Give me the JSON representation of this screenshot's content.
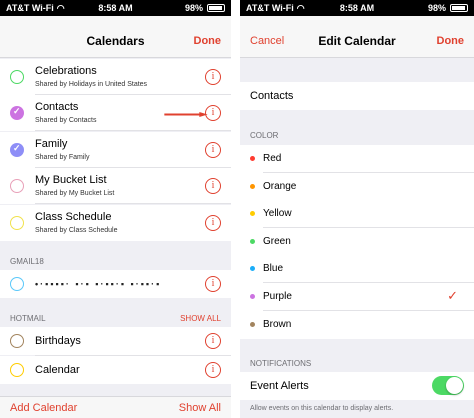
{
  "left": {
    "status": {
      "carrier": "AT&T Wi-Fi",
      "time": "8:58 AM",
      "battery": "98%"
    },
    "nav": {
      "title": "Calendars",
      "done": "Done"
    },
    "calendars": [
      {
        "name": "Celebrations",
        "sub": "Shared by Holidays in United States",
        "color": "#4cd964",
        "checked": false
      },
      {
        "name": "Contacts",
        "sub": "Shared by Contacts",
        "color": "#cc73e1",
        "checked": true
      },
      {
        "name": "Family",
        "sub": "Shared by Family",
        "color": "#8e8ef7",
        "checked": true
      },
      {
        "name": "My Bucket List",
        "sub": "Shared by My Bucket List",
        "color": "#e8a0b8",
        "checked": false
      },
      {
        "name": "Class Schedule",
        "sub": "Shared by Class Schedule",
        "color": "#f1e24c",
        "checked": false
      }
    ],
    "gmail": {
      "label": "GMAIL18",
      "account": "•·▪▪▪▪·  ▪·▪  ▪·▪▪·▪  ▪·▪▪·▪",
      "color": "#5ac8fa"
    },
    "hotmail": {
      "label": "HOTMAIL",
      "show_all": "SHOW ALL",
      "items": [
        {
          "name": "Birthdays",
          "color": "#a2845e"
        },
        {
          "name": "Calendar",
          "color": "#ffcc00"
        }
      ]
    },
    "bottom": {
      "add": "Add Calendar",
      "show_all": "Show All"
    }
  },
  "right": {
    "status": {
      "carrier": "AT&T Wi-Fi",
      "time": "8:58 AM",
      "battery": "98%"
    },
    "nav": {
      "cancel": "Cancel",
      "title": "Edit Calendar",
      "done": "Done"
    },
    "calendar_name": "Contacts",
    "color_label": "COLOR",
    "colors": [
      {
        "name": "Red",
        "hex": "#ff3b30"
      },
      {
        "name": "Orange",
        "hex": "#ff9500"
      },
      {
        "name": "Yellow",
        "hex": "#ffcc00"
      },
      {
        "name": "Green",
        "hex": "#4cd964"
      },
      {
        "name": "Blue",
        "hex": "#1badf8"
      },
      {
        "name": "Purple",
        "hex": "#cc73e1"
      },
      {
        "name": "Brown",
        "hex": "#a2845e"
      }
    ],
    "selected_color": "Purple",
    "notifications_label": "NOTIFICATIONS",
    "event_alerts": "Event Alerts",
    "event_alerts_on": true,
    "footnote": "Allow events on this calendar to display alerts."
  },
  "icons": {
    "info": "info-circle-icon",
    "check": "checkmark-icon",
    "wifi": "wifi-icon",
    "battery": "battery-icon",
    "arrow": "red-arrow-icon"
  },
  "accent": "#e0412f"
}
